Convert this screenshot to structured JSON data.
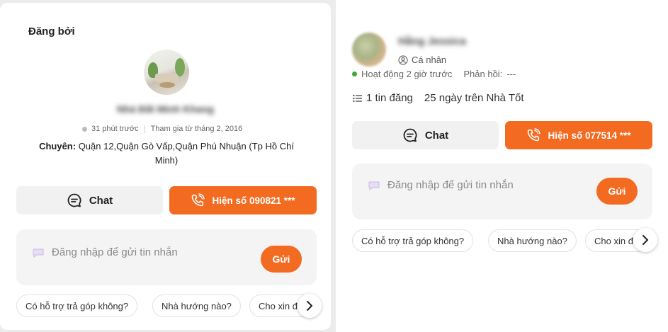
{
  "left": {
    "title": "Đăng bởi",
    "seller_name": "Nhà Đất Minh Khang",
    "last_active": "31 phút trước",
    "joined": "Tham gia từ tháng 2, 2016",
    "specialty_label": "Chuyên:",
    "specialty_line1": "Quận 12,Quận Gò Vấp,Quận Phú Nhuận (Tp Hồ Chí",
    "specialty_line2": "Minh)",
    "chat_label": "Chat",
    "phone_label": "Hiện số 090821 ***",
    "message_placeholder": "Đăng nhập để gửi tin nhắn",
    "send_label": "Gửi",
    "chips": [
      "Có hỗ trợ trả góp không?",
      "Nhà hướng nào?",
      "Cho xin đ"
    ]
  },
  "right": {
    "seller_name": "Hằng Jessica",
    "account_type": "Cá nhân",
    "activity": "Hoạt động 2 giờ trước",
    "reply_label": "Phản hồi:",
    "reply_value": "---",
    "listings": "1 tin đăng",
    "tenure": "25 ngày trên Nhà Tốt",
    "chat_label": "Chat",
    "phone_label": "Hiện số 077514 ***",
    "message_placeholder": "Đăng nhập để gửi tin nhắn",
    "send_label": "Gửi",
    "chips": [
      "Có hỗ trợ trả góp không?",
      "Nhà hướng nào?",
      "Cho xin đ"
    ]
  },
  "colors": {
    "accent": "#f26b21",
    "online": "#3daa3d"
  },
  "icons": [
    "chat-icon",
    "phone-icon",
    "message-bubble-icon",
    "chevron-right-icon",
    "person-icon",
    "list-icon"
  ]
}
